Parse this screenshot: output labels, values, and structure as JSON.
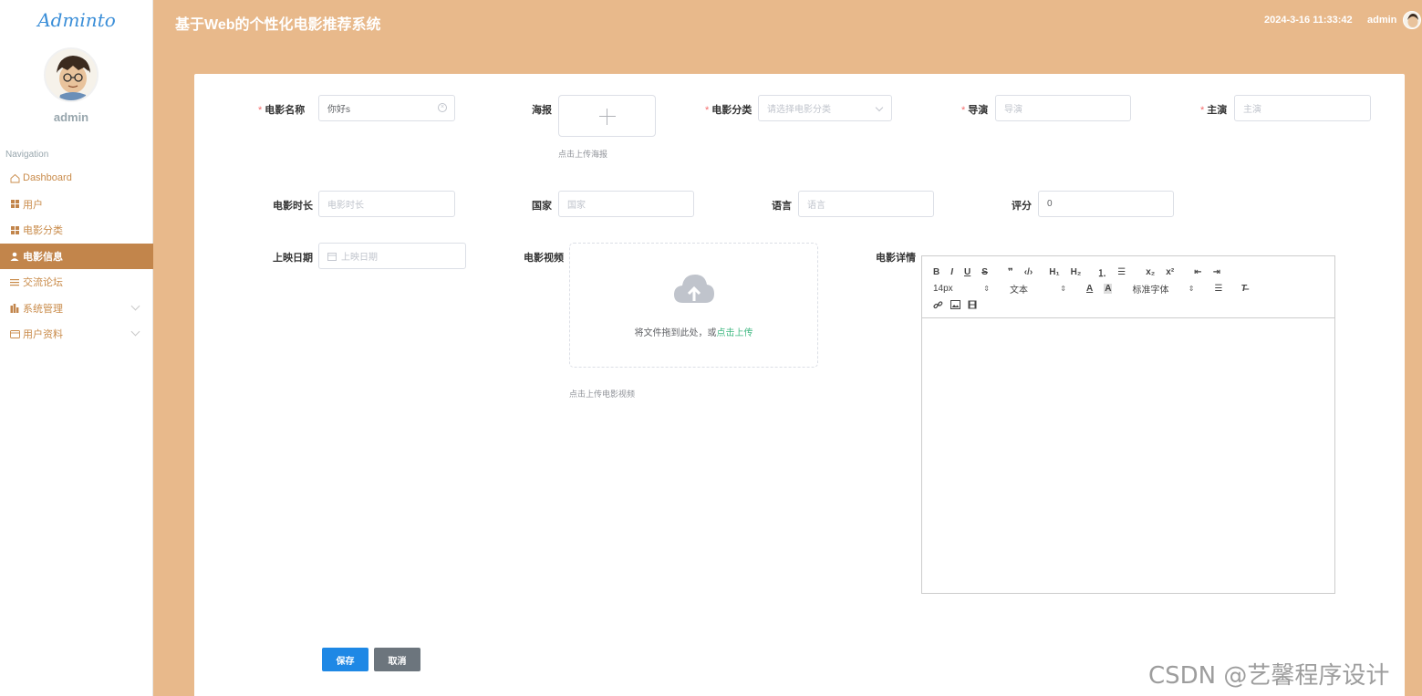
{
  "sidebar": {
    "logo": "Adminto",
    "username": "admin",
    "nav_title": "Navigation",
    "items": [
      {
        "label": "Dashboard",
        "icon": "home-icon"
      },
      {
        "label": "用户",
        "icon": "grid-icon"
      },
      {
        "label": "电影分类",
        "icon": "grid-icon"
      },
      {
        "label": "电影信息",
        "icon": "user-icon",
        "active": true
      },
      {
        "label": "交流论坛",
        "icon": "list-icon"
      },
      {
        "label": "系统管理",
        "icon": "chart-icon",
        "expandable": true
      },
      {
        "label": "用户资料",
        "icon": "card-icon",
        "expandable": true
      }
    ]
  },
  "header": {
    "title": "基于Web的个性化电影推荐系统",
    "datetime": "2024-3-16 11:33:42",
    "user": "admin"
  },
  "form": {
    "name": {
      "label": "电影名称",
      "value": "你好s"
    },
    "poster": {
      "label": "海报",
      "hint": "点击上传海报"
    },
    "category": {
      "label": "电影分类",
      "placeholder": "请选择电影分类"
    },
    "director": {
      "label": "导演",
      "placeholder": "导演"
    },
    "actor": {
      "label": "主演",
      "placeholder": "主演"
    },
    "duration": {
      "label": "电影时长",
      "placeholder": "电影时长"
    },
    "country": {
      "label": "国家",
      "placeholder": "国家"
    },
    "language": {
      "label": "语言",
      "placeholder": "语言"
    },
    "rating": {
      "label": "评分",
      "value": "0"
    },
    "release_date": {
      "label": "上映日期",
      "placeholder": "上映日期"
    },
    "video": {
      "label": "电影视频",
      "drag_text": "将文件拖到此处，或",
      "drag_link": "点击上传",
      "hint": "点击上传电影视频"
    },
    "detail": {
      "label": "电影详情"
    },
    "editor_toolbar": {
      "font_size": "14px",
      "block": "文本",
      "font_family": "标准字体"
    },
    "save": "保存",
    "cancel": "取消"
  },
  "watermark": "CSDN @艺馨程序设计",
  "colors": {
    "header_bg": "#e8b98b",
    "active_nav": "#c2854b",
    "save_btn": "#1e88e5",
    "cancel_btn": "#6c757d",
    "required": "#f56c6c",
    "link": "#42b983"
  }
}
